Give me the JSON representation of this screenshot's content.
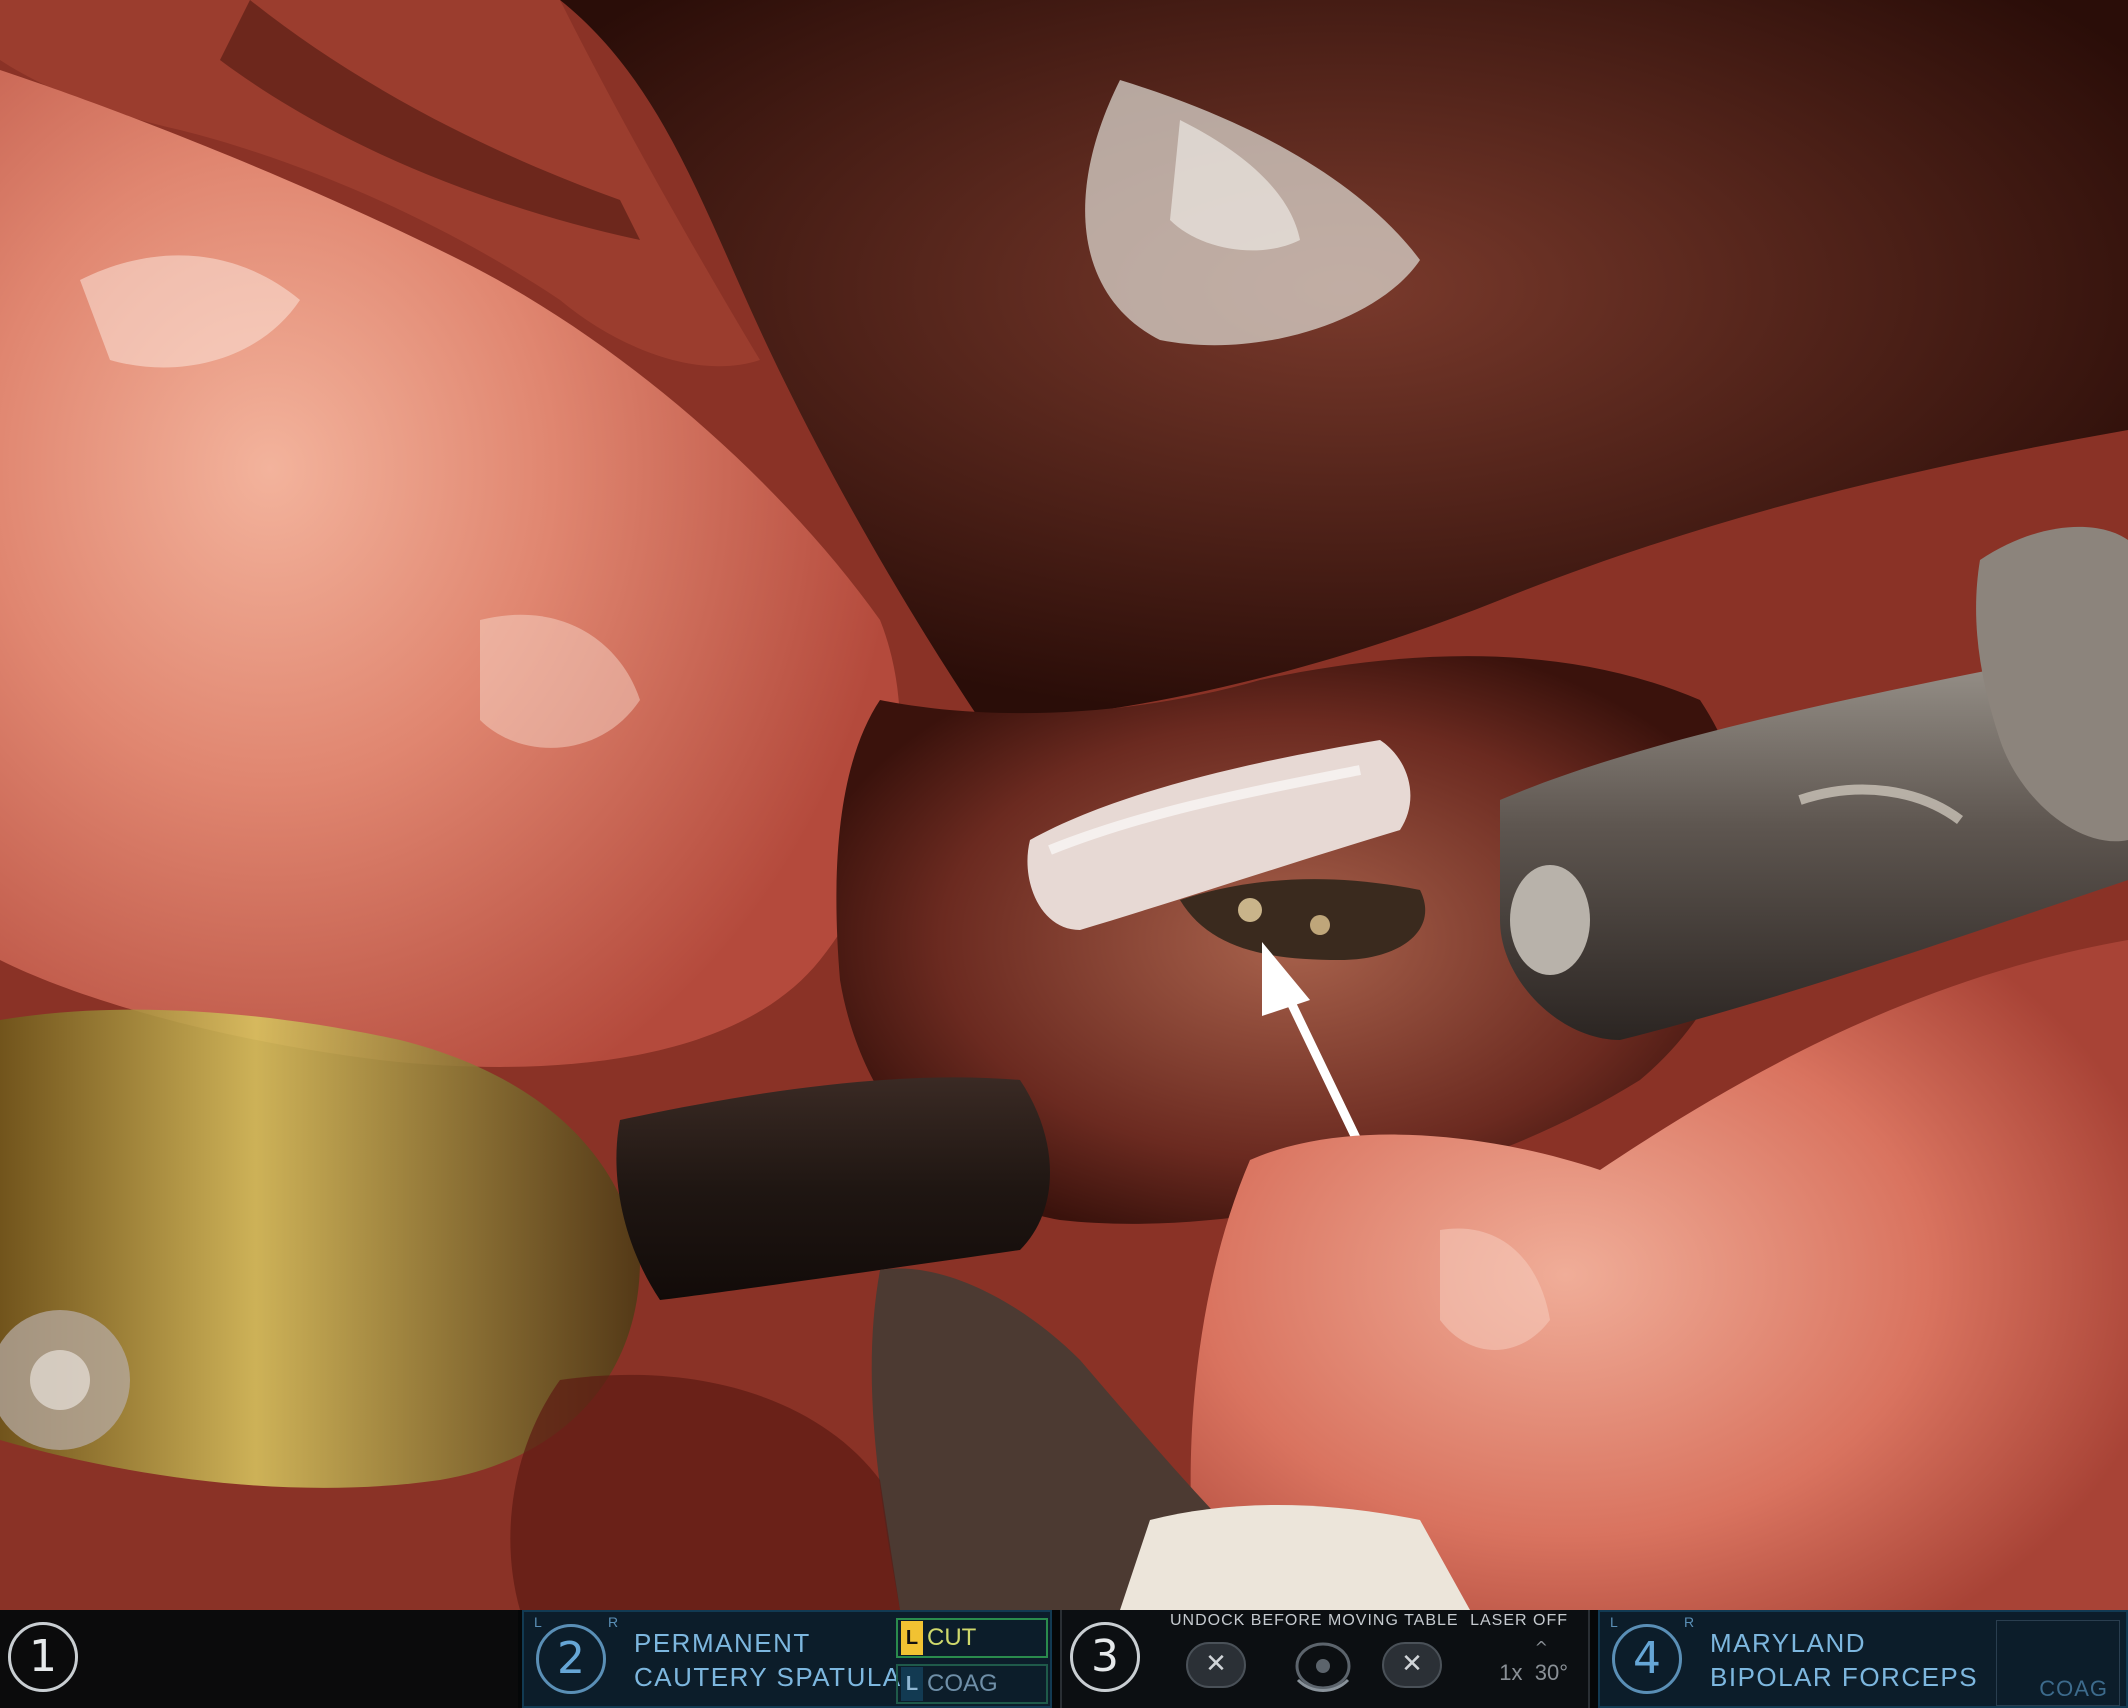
{
  "arms": [
    {
      "number": "1",
      "instrument": "",
      "active": false
    },
    {
      "number": "2",
      "instrument": "PERMANENT\nCAUTERY SPATULA",
      "active": true,
      "energy_cut": {
        "side": "L",
        "label": "CUT"
      },
      "energy_coag": {
        "side": "L",
        "label": "COAG"
      }
    },
    {
      "number": "3",
      "warning": "UNDOCK BEFORE MOVING TABLE",
      "laser": "LASER OFF",
      "zoom": "1x",
      "angle": "30°"
    },
    {
      "number": "4",
      "instrument": "MARYLAND\nBIPOLAR FORCEPS",
      "active": true,
      "energy_coag": {
        "label": "COAG"
      }
    }
  ],
  "lr_marks": {
    "left": "L",
    "right": "R"
  },
  "colors": {
    "panel_active_bg": "#0c1d2a",
    "instrument_text": "#7db7df",
    "cut_tag": "#f1c232",
    "tissue": "#d8705e"
  }
}
